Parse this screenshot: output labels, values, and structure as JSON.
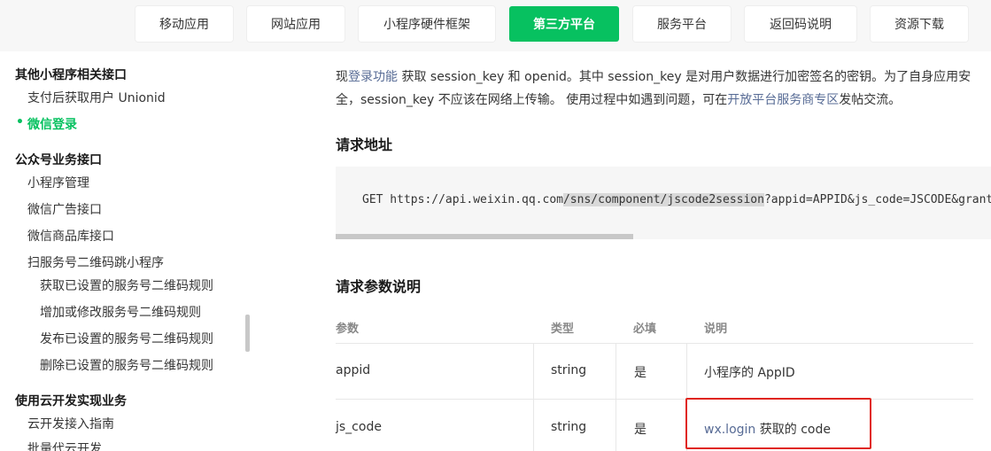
{
  "nav": {
    "items": [
      {
        "label": "移动应用"
      },
      {
        "label": "网站应用"
      },
      {
        "label": "小程序硬件框架"
      },
      {
        "label": "第三方平台"
      },
      {
        "label": "服务平台"
      },
      {
        "label": "返回码说明"
      },
      {
        "label": "资源下载"
      }
    ],
    "active_index": 3,
    "accent": "#07c160"
  },
  "sidebar": {
    "items": [
      {
        "label": "其他小程序相关接口"
      },
      {
        "label": "支付后获取用户 Unionid"
      },
      {
        "label": "微信登录"
      },
      {
        "label": "公众号业务接口"
      },
      {
        "label": "小程序管理"
      },
      {
        "label": "微信广告接口"
      },
      {
        "label": "微信商品库接口"
      },
      {
        "label": "扫服务号二维码跳小程序"
      },
      {
        "label": "获取已设置的服务号二维码规则"
      },
      {
        "label": "增加或修改服务号二维码规则"
      },
      {
        "label": "发布已设置的服务号二维码规则"
      },
      {
        "label": "删除已设置的服务号二维码规则"
      },
      {
        "label": "使用云开发实现业务"
      },
      {
        "label": "云开发接入指南"
      },
      {
        "label": "批量代云开发"
      }
    ]
  },
  "content": {
    "intro": {
      "p1_a": "现",
      "p1_link": "登录功能",
      "p1_b": " 获取 session_key 和 openid。其中 session_key 是对用户数据进行加密签名的密钥。为了自身应用安全，session_key 不应该在网络上传输。 使用过程中如遇到问题，可在",
      "p1_link2": "开放平台服务商专区",
      "p1_c": "发帖交流。"
    },
    "request_url_title": "请求地址",
    "code": {
      "pre": "GET https://api.weixin.qq.com",
      "hl": "/sns/component/jscode2session",
      "post": "?appid=APPID&js_code=JSCODE&grant_type=authorization_code&component_appid=COMPONENT_APPID&component_access_token=ACCESS_TOKEN"
    },
    "params_title": "请求参数说明",
    "table": {
      "headers": [
        "参数",
        "类型",
        "必填",
        "说明"
      ],
      "rows": [
        {
          "param": "appid",
          "type": "string",
          "required": "是",
          "desc": "小程序的 AppID",
          "desc_link": ""
        },
        {
          "param": "js_code",
          "type": "string",
          "required": "是",
          "desc": " 获取的 code",
          "desc_link": "wx.login"
        }
      ]
    }
  }
}
